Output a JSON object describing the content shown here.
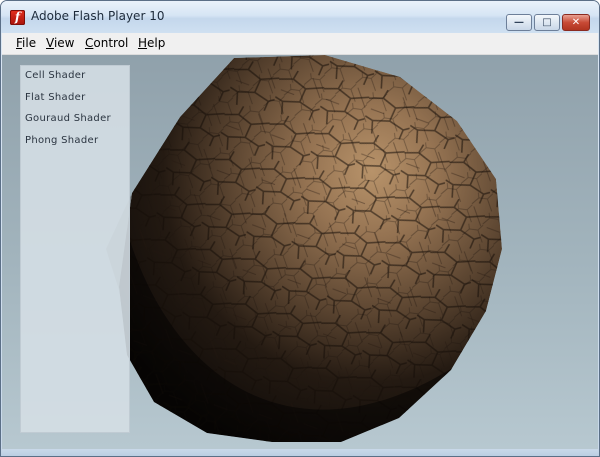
{
  "window": {
    "title": "Adobe Flash Player 10",
    "app_icon_glyph": "f",
    "app_icon": "flash-player-icon",
    "controls": {
      "minimize_glyph": "—",
      "maximize_glyph": "□",
      "close_glyph": "✕"
    }
  },
  "menu": {
    "items": [
      "File",
      "View",
      "Control",
      "Help"
    ]
  },
  "panel": {
    "items": [
      "Cell Shader",
      "Flat Shader",
      "Gouraud Shader",
      "Phong Shader"
    ]
  },
  "colors": {
    "stage_background": "#a3b5be",
    "sphere_light": "#b8936a",
    "sphere_dark": "#0c0907",
    "shadow": "#7e8589",
    "close_button": "#c84a36"
  }
}
